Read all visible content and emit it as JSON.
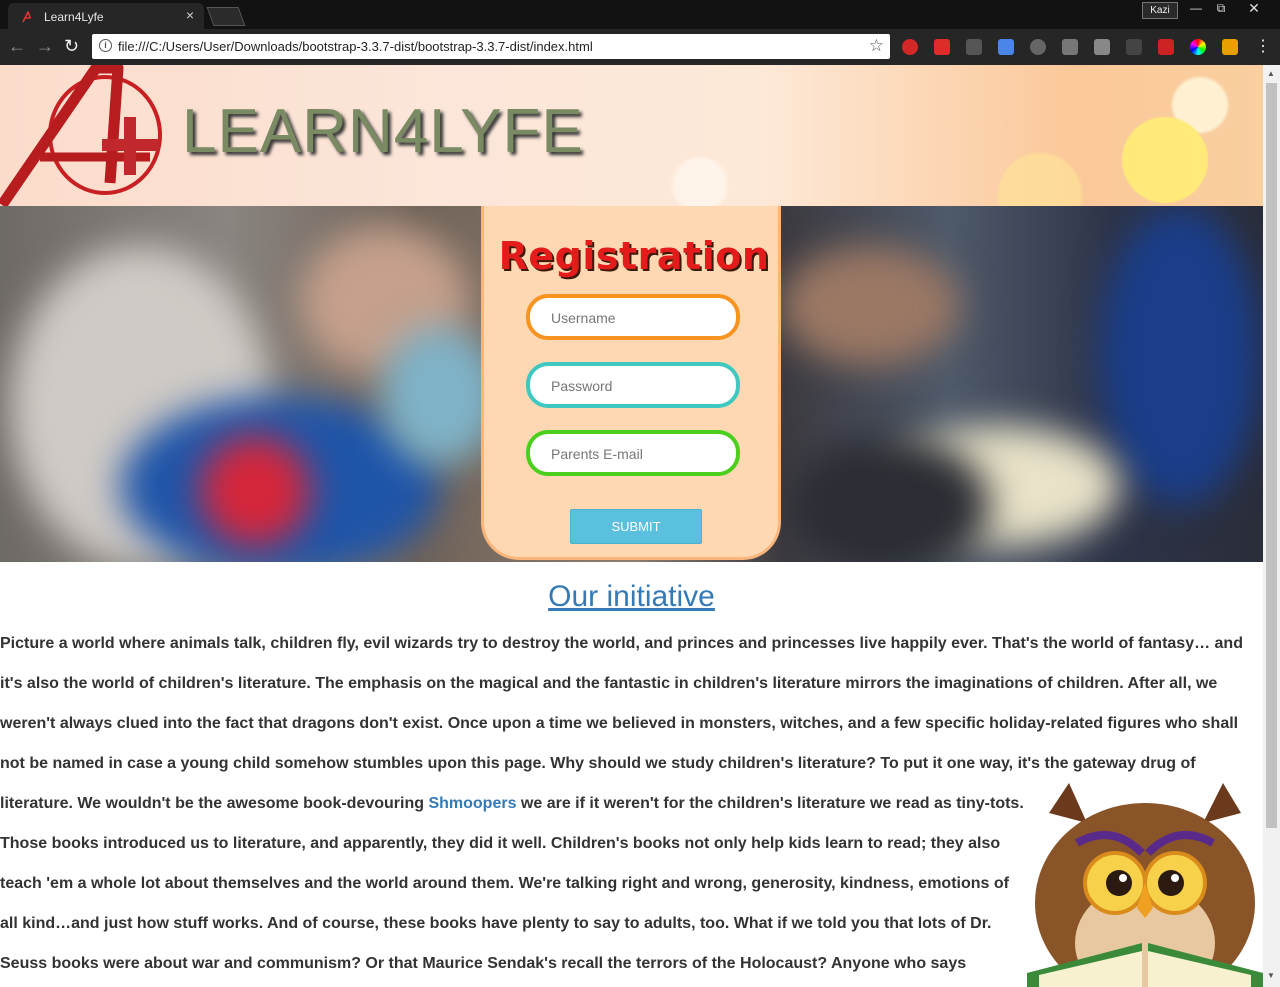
{
  "browser": {
    "tab_title": "Learn4Lyfe",
    "tab_close": "×",
    "profile": "Kazi",
    "url": "file:///C:/Users/User/Downloads/bootstrap-3.3.7-dist/bootstrap-3.3.7-dist/index.html"
  },
  "header": {
    "brand": "LEARN4LYFE"
  },
  "registration": {
    "title": "Registration",
    "username_placeholder": "Username",
    "password_placeholder": "Password",
    "email_placeholder": "Parents E-mail",
    "submit_label": "SUBMIT"
  },
  "content": {
    "heading": "Our initiative",
    "lines": [
      "Picture a world where animals talk, children fly, evil wizards try to destroy the world, and princes and princesses live happily ever. That's the world of fantasy… and",
      "it's also the world of children's literature. The emphasis on the magical and the fantastic in children's literature mirrors the imaginations of children. After all, we",
      "weren't always clued into the fact that dragons don't exist. Once upon a time we believed in monsters, witches, and a few specific holiday-related figures who shall",
      "not be named in case a young child somehow stumbles upon this page. Why should we study children's literature? To put it one way, it's the gateway drug of"
    ],
    "line5_before": "literature. We wouldn't be the awesome book-devouring ",
    "line5_link": "Shmoopers",
    "line5_after": " we are if it weren't for the children's literature we read as tiny-tots.",
    "lines_after": [
      "Those books introduced us to literature, and apparently, they did it well. Children's books not only help kids learn to read; they also",
      "teach 'em a whole lot about themselves and the world around them. We're talking right and wrong, generosity, kindness, emotions of",
      "all kind…and just how stuff works. And of course, these books have plenty to say to adults, too. What if we told you that lots of Dr.",
      "Seuss books were about war and communism? Or that Maurice Sendak's recall the terrors of the Holocaust? Anyone who says"
    ]
  },
  "colors": {
    "accent_link": "#337ab7",
    "username_border": "#f7931e",
    "password_border": "#3ec8c0",
    "email_border": "#49cf1c",
    "submit_bg": "#5bc0de",
    "card_bg": "#fdd8b2"
  }
}
